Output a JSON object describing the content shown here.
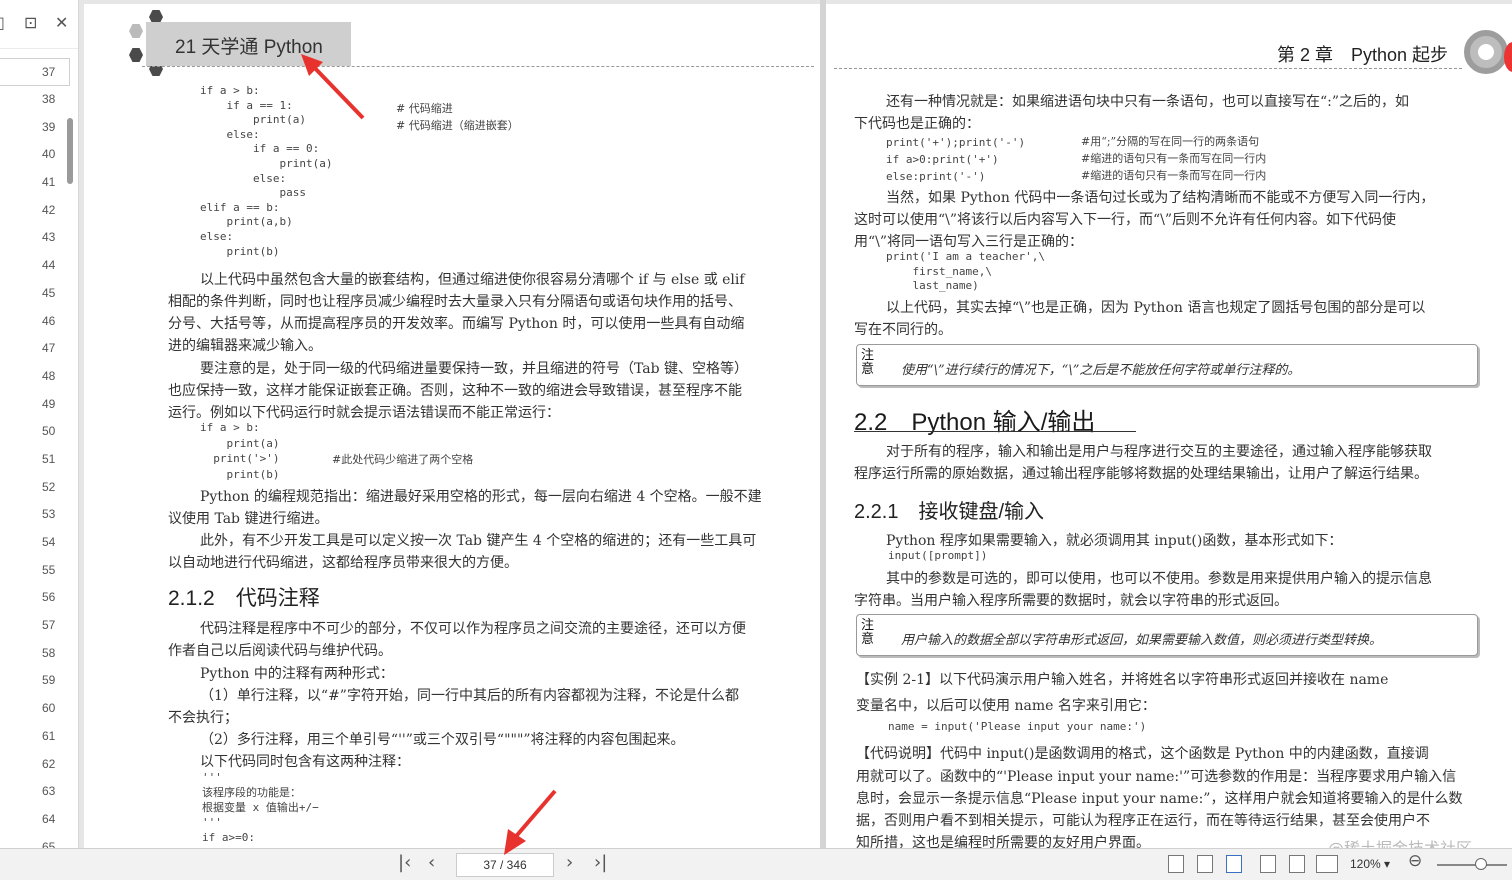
{
  "sidebar": {
    "icons": [
      "page-thumbnail-icon",
      "bookmark-icon",
      "close-icon"
    ],
    "current_page": "37",
    "pages": [
      "37",
      "38",
      "39",
      "40",
      "41",
      "42",
      "43",
      "44",
      "45",
      "46",
      "47",
      "48",
      "49",
      "50",
      "51",
      "52",
      "53",
      "54",
      "55",
      "56",
      "57",
      "58",
      "59",
      "60",
      "61",
      "62",
      "63",
      "64",
      "65"
    ]
  },
  "left_page": {
    "banner": "21 天学通 Python",
    "code1": [
      "if a > b:",
      "    if a == 1:",
      "        print(a)",
      "    else:",
      "        if a == 0:",
      "            print(a)",
      "        else:",
      "            pass",
      "elif a == b:",
      "    print(a,b)",
      "else:",
      "    print(b)"
    ],
    "code1_comments": [
      "# 代码缩进",
      "# 代码缩进（缩进嵌套）"
    ],
    "para1": [
      "以上代码中虽然包含大量的嵌套结构，但通过缩进使你很容易分清哪个 if 与 else 或 elif",
      "相配的条件判断，同时也让程序员减少编程时去大量录入只有分隔语句或语句块作用的括号、",
      "分号、大括号等，从而提高程序员的开发效率。而编写 Python 时，可以使用一些具有自动缩",
      "进的编辑器来减少输入。"
    ],
    "para2": [
      "要注意的是，处于同一级的代码缩进量要保持一致，并且缩进的符号（Tab 键、空格等）",
      "也应保持一致，这样才能保证嵌套正确。否则，这种不一致的缩进会导致错误，甚至程序不能",
      "运行。例如以下代码运行时就会提示语法错误而不能正常运行："
    ],
    "code2": [
      "if a > b:",
      "    print(a)",
      "  print('>')",
      "    print(b)"
    ],
    "code2_comment": "#此处代码少缩进了两个空格",
    "para3": [
      "Python 的编程规范指出：缩进最好采用空格的形式，每一层向右缩进 4 个空格。一般不建",
      "议使用 Tab 键进行缩进。"
    ],
    "para4": [
      "此外，有不少开发工具是可以定义按一次 Tab 键产生 4 个空格的缩进的；还有一些工具可",
      "以自动地进行代码缩进，这都给程序员带来很大的方便。"
    ],
    "section": "2.1.2　代码注释",
    "para5": [
      "代码注释是程序中不可少的部分，不仅可以作为程序员之间交流的主要途径，还可以方便",
      "作者自己以后阅读代码与维护代码。"
    ],
    "para6": "Python 中的注释有两种形式：",
    "para7": [
      "（1）单行注释，以“#”字符开始，同一行中其后的所有内容都视为注释，不论是什么都",
      "不会执行；"
    ],
    "para8": "（2）多行注释，用三个单引号“''”或三个双引号“\"\"\"”将注释的内容包围起来。",
    "para9": "以下代码同时包含有这两种注释：",
    "code3": [
      "'''",
      "该程序段的功能是：",
      "根据变量 x 值输出+/−",
      "'''",
      "if a>=0:"
    ]
  },
  "right_page": {
    "header": "第 2 章　Python 起步",
    "para1": [
      "还有一种情况就是：如果缩进语句块中只有一条语句，也可以直接写在“:”之后的，如",
      "下代码也是正确的："
    ],
    "code1": [
      "print('+');print('-')",
      "if a>0:print('+')",
      "else:print('-')"
    ],
    "code1_comments": [
      "#用“;”分隔的写在同一行的两条语句",
      "#缩进的语句只有一条而写在同一行内",
      "#缩进的语句只有一条而写在同一行内"
    ],
    "para2": [
      "当然，如果 Python 代码中一条语句过长或为了结构清晰而不能或不方便写入同一行内，",
      "这时可以使用“\\”将该行以后内容写入下一行，而“\\”后则不允许有任何内容。如下代码使",
      "用“\\”将同一语句写入三行是正确的："
    ],
    "code2": [
      "print('I am a teacher',\\",
      "    first_name,\\",
      "    last_name)"
    ],
    "para3": [
      "以上代码，其实去掉“\\”也是正确，因为 Python 语言也规定了圆括号包围的部分是可以",
      "写在不同行的。"
    ],
    "note_label": "注意",
    "note1": "使用“\\”进行续行的情况下，“\\”之后是不能放任何字符或单行注释的。",
    "section": "2.2　Python 输入/输出",
    "para4": [
      "对于所有的程序，输入和输出是用户与程序进行交互的主要途径，通过输入程序能够获取",
      "程序运行所需的原始数据，通过输出程序能够将数据的处理结果输出，让用户了解运行结果。"
    ],
    "subsection": "2.2.1　接收键盘/输入",
    "para5": "Python 程序如果需要输入，就必须调用其 input()函数，基本形式如下：",
    "code3": "input([prompt])",
    "para6": [
      "其中的参数是可选的，即可以使用，也可以不使用。参数是用来提供用户输入的提示信息",
      "字符串。当用户输入程序所需要的数据时，就会以字符串的形式返回。"
    ],
    "note2": "用户输入的数据全部以字符串形式返回，如果需要输入数值，则必须进行类型转换。",
    "example": [
      "【实例 2-1】以下代码演示用户输入姓名，并将姓名以字符串形式返回并接收在 name",
      "变量名中，以后可以使用 name 名字来引用它："
    ],
    "code4": "name = input('Please input your name:')",
    "para7": [
      "【代码说明】代码中 input()是函数调用的格式，这个函数是 Python 中的内建函数，直接调",
      "用就可以了。函数中的“'Please input your name:'”可选参数的作用是：当程序要求用户输入信",
      "息时，会显示一条提示信息“Please input your name:”，这样用户就会知道将要输入的是什么数",
      "据，否则用户看不到相关提示，可能认为程序正在运行，而在等待运行结果，甚至会使用户不",
      "知所措，这也是编程时所需要的友好用户界面。"
    ]
  },
  "bottom_bar": {
    "page_indicator": "37 / 346",
    "zoom": "120%",
    "watermark": "@稀土掘金技术社区"
  }
}
